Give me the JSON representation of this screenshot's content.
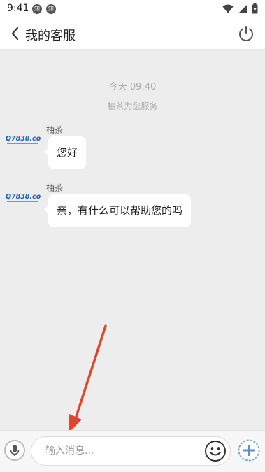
{
  "status_bar": {
    "time": "9:41",
    "notif1": "知",
    "notif2": "知"
  },
  "header": {
    "title": "我的客服"
  },
  "chat": {
    "system_time": "今天 09:40",
    "system_message": "柚茶为您服务",
    "avatar_text": "Q7838.com",
    "messages": [
      {
        "sender": "柚茶",
        "text": "您好"
      },
      {
        "sender": "柚茶",
        "text": "亲，有什么可以帮助您的吗"
      }
    ]
  },
  "input_bar": {
    "placeholder": "输入消息..."
  },
  "colors": {
    "chat_background": "#ededed",
    "bubble": "#ffffff",
    "arrow": "#e0452e"
  }
}
